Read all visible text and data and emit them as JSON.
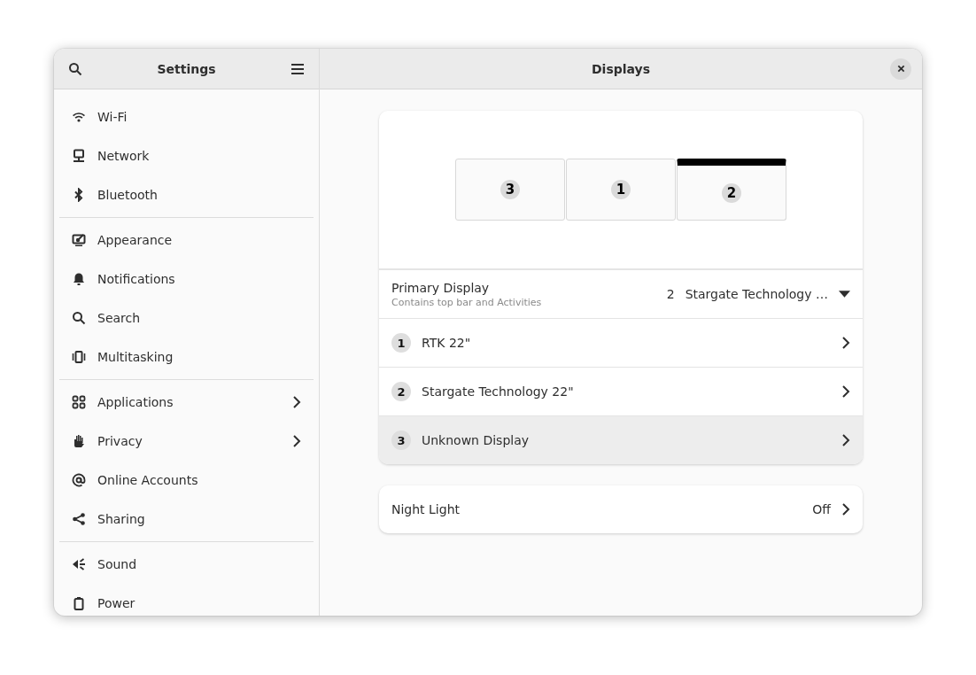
{
  "sidebar": {
    "title": "Settings",
    "groups": [
      [
        {
          "label": "Wi-Fi",
          "submenu": false
        },
        {
          "label": "Network",
          "submenu": false
        },
        {
          "label": "Bluetooth",
          "submenu": false
        }
      ],
      [
        {
          "label": "Appearance",
          "submenu": false
        },
        {
          "label": "Notifications",
          "submenu": false
        },
        {
          "label": "Search",
          "submenu": false
        },
        {
          "label": "Multitasking",
          "submenu": false
        }
      ],
      [
        {
          "label": "Applications",
          "submenu": true
        },
        {
          "label": "Privacy",
          "submenu": true
        },
        {
          "label": "Online Accounts",
          "submenu": false
        },
        {
          "label": "Sharing",
          "submenu": false
        }
      ],
      [
        {
          "label": "Sound",
          "submenu": false
        },
        {
          "label": "Power",
          "submenu": false
        }
      ]
    ]
  },
  "content": {
    "title": "Displays",
    "arrangement": [
      {
        "number": "3",
        "primary": false
      },
      {
        "number": "1",
        "primary": false
      },
      {
        "number": "2",
        "primary": true
      }
    ],
    "primary_display": {
      "label": "Primary Display",
      "subtitle": "Contains top bar and Activities",
      "number": "2",
      "value": "Stargate Technology …"
    },
    "displays": [
      {
        "number": "1",
        "name": "RTK 22\"",
        "hovered": false
      },
      {
        "number": "2",
        "name": "Stargate Technology 22\"",
        "hovered": false
      },
      {
        "number": "3",
        "name": "Unknown Display",
        "hovered": true
      }
    ],
    "night_light": {
      "label": "Night Light",
      "value": "Off"
    }
  }
}
